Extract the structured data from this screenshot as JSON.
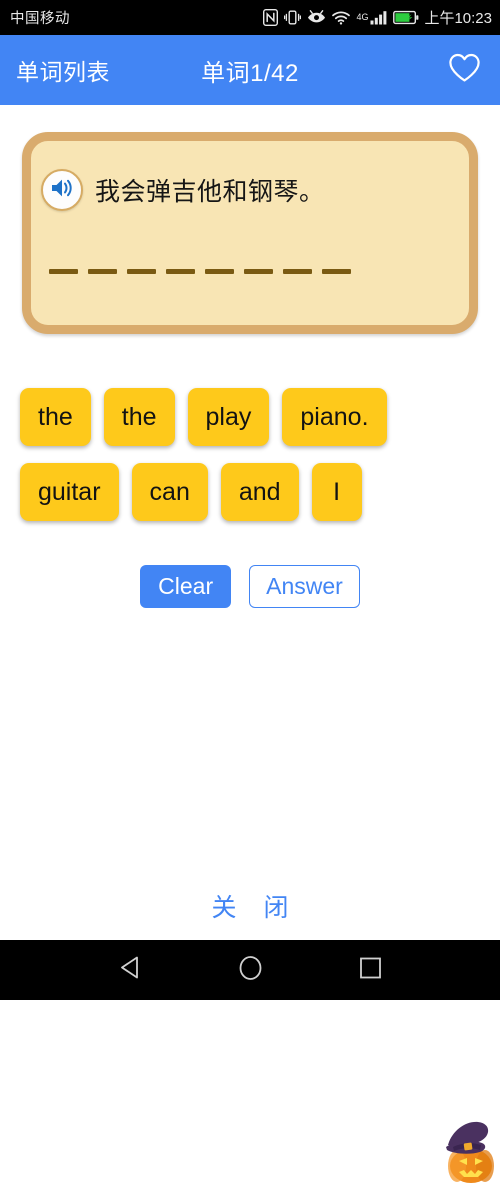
{
  "status_bar": {
    "carrier": "中国移动",
    "clock": "上午10:23",
    "network_label": "4G",
    "icons": [
      "nfc-icon",
      "vibrate-icon",
      "eye-care-icon",
      "wifi-icon",
      "signal-icon",
      "battery-charging-icon"
    ]
  },
  "app_bar": {
    "back_label": "单词列表",
    "title": "单词1/42",
    "favorite_icon": "heart-outline-icon",
    "background_color": "#4285f4"
  },
  "card": {
    "question_text": "我会弹吉他和钢琴。",
    "speaker_icon": "speaker-icon",
    "blank_dash_count": 8,
    "fill_color": "#f8e5b4",
    "border_color": "#d9ab6d"
  },
  "word_tiles": {
    "color": "#fec91b",
    "rows": [
      [
        "the",
        "the",
        "play",
        "piano."
      ],
      [
        "guitar",
        "can",
        "and",
        "I"
      ]
    ]
  },
  "actions": {
    "clear_label": "Clear",
    "answer_label": "Answer",
    "accent_color": "#4285f4",
    "mascot_icon": "jack-o-lantern-witch-hat-icon"
  },
  "footer": {
    "close_label": "关 闭"
  },
  "nav_bar": {
    "back_icon": "back-triangle-icon",
    "home_icon": "home-circle-icon",
    "recents_icon": "recents-square-icon"
  }
}
